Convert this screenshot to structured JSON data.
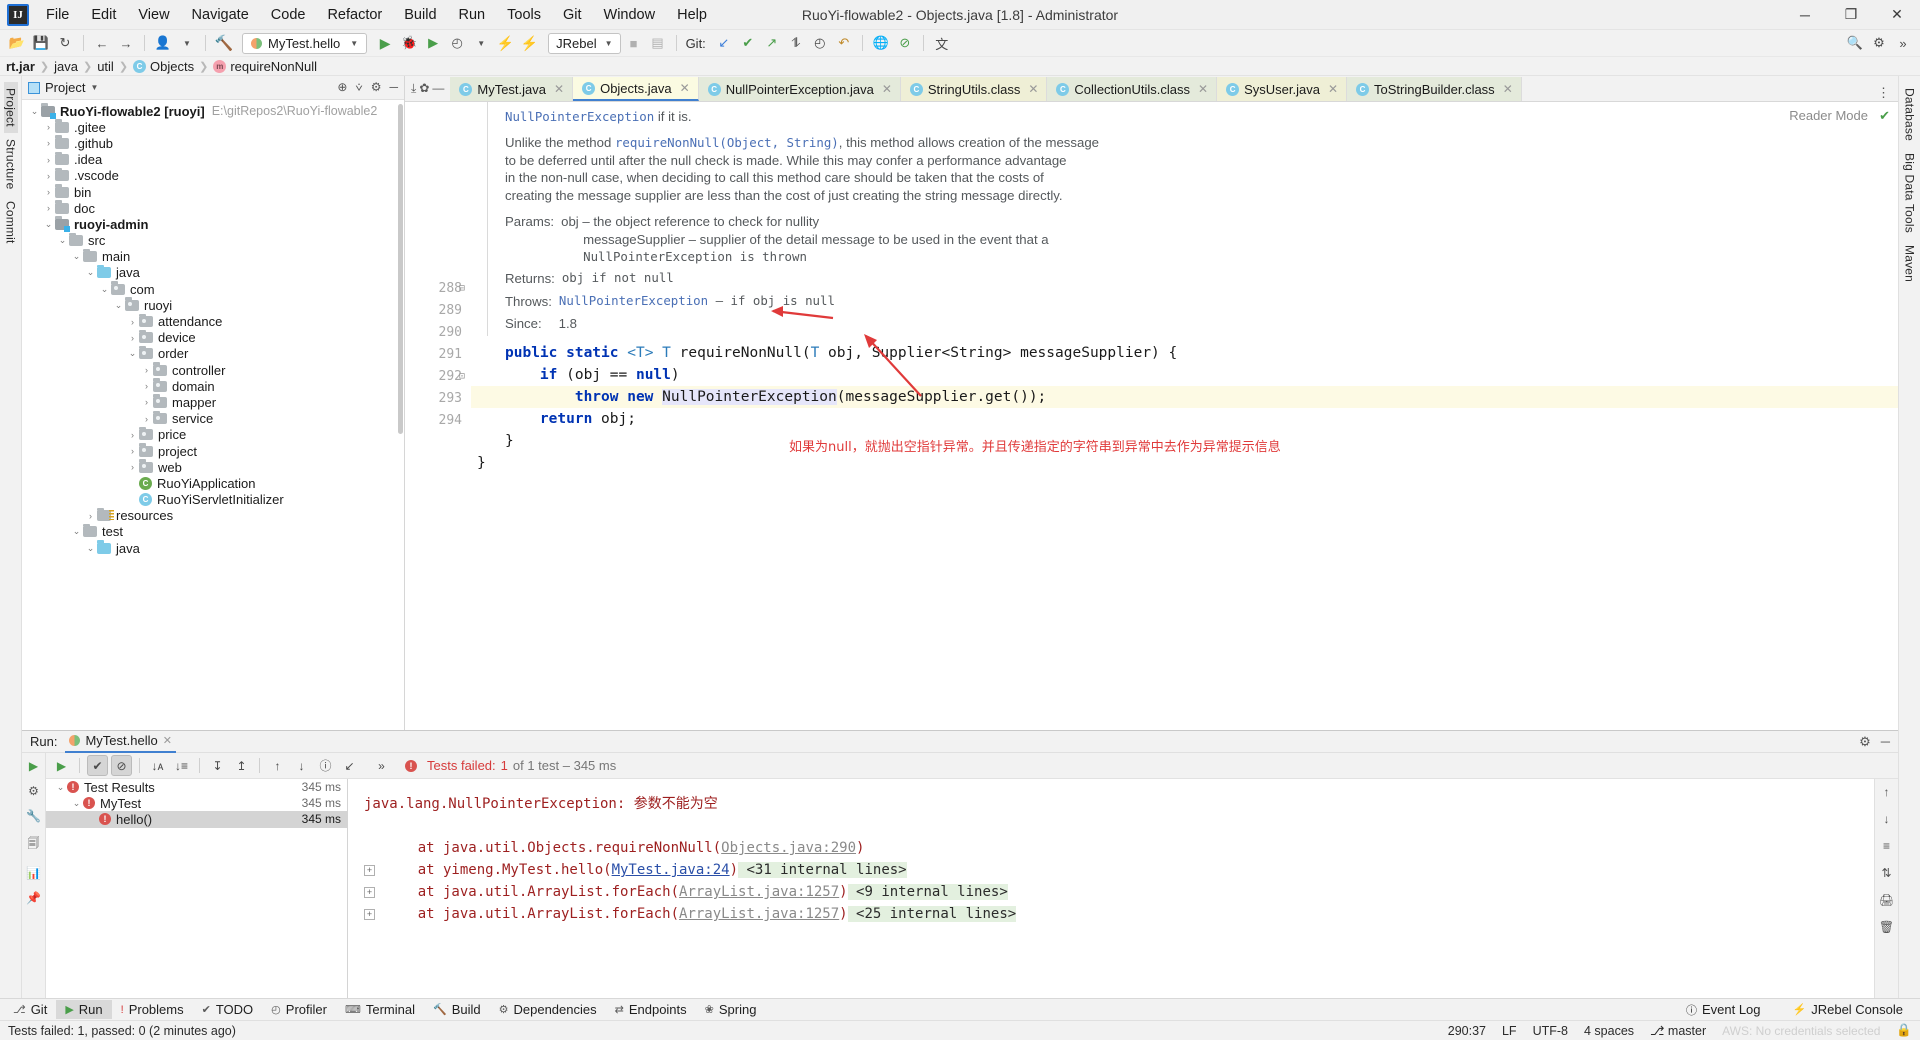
{
  "window": {
    "title": "RuoYi-flowable2 - Objects.java [1.8] - Administrator",
    "logo": "IJ",
    "minimize": "─",
    "maximize": "❐",
    "close": "✕"
  },
  "menubar": [
    {
      "label": "File"
    },
    {
      "label": "Edit"
    },
    {
      "label": "View"
    },
    {
      "label": "Navigate"
    },
    {
      "label": "Code"
    },
    {
      "label": "Refactor"
    },
    {
      "label": "Build"
    },
    {
      "label": "Run"
    },
    {
      "label": "Tools"
    },
    {
      "label": "Git"
    },
    {
      "label": "Window"
    },
    {
      "label": "Help"
    }
  ],
  "toolbar": {
    "open_icon": "📂",
    "save_icon": "💾",
    "sync_icon": "↻",
    "back_icon": "←",
    "forward_icon": "→",
    "profile_icon": "👤",
    "build_icon": "🔨",
    "run_config": "MyTest.hello",
    "run_icon": "▶",
    "debug_icon": "🐞",
    "run_coverage_icon": "▶",
    "profiler_icon": "◴",
    "jrebel_run_icon": "⚡",
    "jrebel_label": "JRebel",
    "stop_icon": "■",
    "layout_icon": "▤",
    "git_label": "Git:",
    "git_update_icon": "↙",
    "git_commit_icon": "✔",
    "git_push_icon": "↗",
    "git_branch_icon": "⥮",
    "git_history_icon": "◴",
    "undo_icon": "↶",
    "browser_icon": "🌐",
    "inspect_icon": "⊘",
    "translate_icon": "文",
    "search_icon": "🔍",
    "settings_icon": "⚙",
    "expand_icon": "»"
  },
  "breadcrumb": [
    {
      "label": "rt.jar",
      "bold": true,
      "icon": null
    },
    {
      "label": "java",
      "bold": false,
      "icon": null
    },
    {
      "label": "util",
      "bold": false,
      "icon": null
    },
    {
      "label": "Objects",
      "bold": false,
      "icon": "C"
    },
    {
      "label": "requireNonNull",
      "bold": false,
      "icon": "m"
    }
  ],
  "left_rail": [
    "Project",
    "Structure",
    "Commit"
  ],
  "right_rail": [
    "Database",
    "Big Data Tools",
    "Maven"
  ],
  "project_panel": {
    "title": "Project",
    "chevron": "▾",
    "locate_icon": "⊕",
    "collapse_icon": "⩒",
    "settings_icon": "⚙",
    "hide_icon": "─",
    "tree": [
      {
        "indent": 0,
        "arrow": "⌄",
        "type": "module",
        "label": "RuoYi-flowable2 [ruoyi]",
        "bold": true,
        "path": "E:\\gitRepos2\\RuoYi-flowable2"
      },
      {
        "indent": 1,
        "arrow": "›",
        "type": "folder",
        "label": ".gitee"
      },
      {
        "indent": 1,
        "arrow": "›",
        "type": "folder",
        "label": ".github"
      },
      {
        "indent": 1,
        "arrow": "›",
        "type": "folder",
        "label": ".idea"
      },
      {
        "indent": 1,
        "arrow": "›",
        "type": "folder",
        "label": ".vscode"
      },
      {
        "indent": 1,
        "arrow": "›",
        "type": "folder",
        "label": "bin"
      },
      {
        "indent": 1,
        "arrow": "›",
        "type": "folder",
        "label": "doc"
      },
      {
        "indent": 1,
        "arrow": "⌄",
        "type": "module",
        "label": "ruoyi-admin",
        "bold": true
      },
      {
        "indent": 2,
        "arrow": "⌄",
        "type": "folder",
        "label": "src"
      },
      {
        "indent": 3,
        "arrow": "⌄",
        "type": "folder",
        "label": "main"
      },
      {
        "indent": 4,
        "arrow": "⌄",
        "type": "source",
        "label": "java"
      },
      {
        "indent": 5,
        "arrow": "⌄",
        "type": "package",
        "label": "com"
      },
      {
        "indent": 6,
        "arrow": "⌄",
        "type": "package",
        "label": "ruoyi"
      },
      {
        "indent": 7,
        "arrow": "›",
        "type": "package",
        "label": "attendance"
      },
      {
        "indent": 7,
        "arrow": "›",
        "type": "package",
        "label": "device"
      },
      {
        "indent": 7,
        "arrow": "⌄",
        "type": "package",
        "label": "order"
      },
      {
        "indent": 8,
        "arrow": "›",
        "type": "package",
        "label": "controller"
      },
      {
        "indent": 8,
        "arrow": "›",
        "type": "package",
        "label": "domain"
      },
      {
        "indent": 8,
        "arrow": "›",
        "type": "package",
        "label": "mapper"
      },
      {
        "indent": 8,
        "arrow": "›",
        "type": "package",
        "label": "service"
      },
      {
        "indent": 7,
        "arrow": "›",
        "type": "package",
        "label": "price"
      },
      {
        "indent": 7,
        "arrow": "›",
        "type": "package",
        "label": "project"
      },
      {
        "indent": 7,
        "arrow": "›",
        "type": "package",
        "label": "web"
      },
      {
        "indent": 7,
        "arrow": "",
        "type": "spring-class",
        "label": "RuoYiApplication"
      },
      {
        "indent": 7,
        "arrow": "",
        "type": "class",
        "label": "RuoYiServletInitializer"
      },
      {
        "indent": 4,
        "arrow": "›",
        "type": "resources",
        "label": "resources"
      },
      {
        "indent": 3,
        "arrow": "⌄",
        "type": "folder",
        "label": "test"
      },
      {
        "indent": 4,
        "arrow": "⌄",
        "type": "source",
        "label": "java"
      }
    ]
  },
  "editor": {
    "tabs": [
      {
        "label": "MyTest.java",
        "icon": "C",
        "active": false,
        "modified": true
      },
      {
        "label": "Objects.java",
        "icon": "C",
        "active": true
      },
      {
        "label": "NullPointerException.java",
        "icon": "C",
        "active": false
      },
      {
        "label": "StringUtils.class",
        "icon": "C",
        "active": false
      },
      {
        "label": "CollectionUtils.class",
        "icon": "C",
        "active": false
      },
      {
        "label": "SysUser.java",
        "icon": "C",
        "active": false
      },
      {
        "label": "ToStringBuilder.class",
        "icon": "C",
        "active": false
      }
    ],
    "tab_close": "✕",
    "tab_overflow": "⋮",
    "reader_mode": "Reader Mode",
    "inspection_ok": "✔",
    "javadoc": {
      "line1_pre": "",
      "line1_link": "NullPointerException",
      "line1_post": " if it is.",
      "para2_a": "Unlike the method ",
      "para2_code": "requireNonNull(Object, String)",
      "para2_b": ", this method allows creation of the message",
      "para2_lines": [
        "to be deferred until after the null check is made. While this may confer a performance advantage",
        "in the non-null case, when deciding to call this method care should be taken that the costs of",
        "creating the message supplier are less than the cost of just creating the string message directly."
      ],
      "params_key": "Params:",
      "params": [
        "obj – the object reference to check for nullity",
        "messageSupplier – supplier of the detail message to be used in the event that a",
        "NullPointerException is thrown"
      ],
      "returns_key": "Returns:",
      "returns_val": "obj if not null",
      "throws_key": "Throws:",
      "throws_link": "NullPointerException",
      "throws_val": " – if obj is null",
      "since_key": "Since:",
      "since_val": "1.8"
    },
    "line_numbers": [
      "288",
      "289",
      "290",
      "291",
      "292",
      "293",
      "294"
    ],
    "code": [
      "public static <T> T requireNonNull(T obj, Supplier<String> messageSupplier) {",
      "    if (obj == null)",
      "        throw new NullPointerException(messageSupplier.get());",
      "    return obj;",
      "}",
      "}",
      ""
    ],
    "highlight_line": "290",
    "annotation_cn": "如果为null，就抛出空指针异常。并且传递指定的字符串到异常中去作为异常提示信息",
    "annotation_color": "#e03a3a"
  },
  "run_panel": {
    "label": "Run:",
    "tab_name": "MyTest.hello",
    "tab_close": "✕",
    "settings_icon": "⚙",
    "hide_icon": "─",
    "toolbar": {
      "rerun_icon": "▶",
      "show_passed_icon": "✔",
      "show_ignored_icon": "⊘",
      "sort_alpha_icon": "↓ᴀ",
      "sort_duration_icon": "↓≡",
      "expand_all_icon": "↧",
      "collapse_all_icon": "↥",
      "prev_fail_icon": "↑",
      "next_fail_icon": "↓",
      "history_icon": "ⓘ",
      "export_icon": "↙",
      "more_icon": "»"
    },
    "status_icon": "!",
    "status_prefix": "Tests failed:",
    "status_count": "1",
    "status_suffix": "of 1 test – 345 ms",
    "status_color": "#d63b3b",
    "tree": [
      {
        "indent": 0,
        "arrow": "⌄",
        "label": "Test Results",
        "time": "345 ms",
        "selected": false
      },
      {
        "indent": 1,
        "arrow": "⌄",
        "label": "MyTest",
        "time": "345 ms",
        "selected": false
      },
      {
        "indent": 2,
        "arrow": "",
        "label": "hello()",
        "time": "345 ms",
        "selected": true
      }
    ],
    "console": {
      "exception_line": "java.lang.NullPointerException: 参数不能为空",
      "frames": [
        {
          "fold": false,
          "text_pre": "    at java.util.Objects.requireNonNull(",
          "link": "Objects.java:290",
          "link_style": "gray",
          "text_post": ")",
          "internal": ""
        },
        {
          "fold": true,
          "text_pre": "    at yimeng.MyTest.hello(",
          "link": "MyTest.java:24",
          "link_style": "blue",
          "text_post": ")",
          "internal": "<31 internal lines>"
        },
        {
          "fold": true,
          "text_pre": "    at java.util.ArrayList.forEach(",
          "link": "ArrayList.java:1257",
          "link_style": "gray",
          "text_post": ")",
          "internal": "<9 internal lines>"
        },
        {
          "fold": true,
          "text_pre": "    at java.util.ArrayList.forEach(",
          "link": "ArrayList.java:1257",
          "link_style": "gray",
          "text_post": ")",
          "internal": "<25 internal lines>"
        }
      ]
    },
    "console_rail_icons": [
      "↑",
      "↓",
      "≡",
      "⇅",
      "🖨",
      "🗑"
    ],
    "left_rail_icons": [
      "▶",
      "⚙",
      "🔧",
      "📋",
      "📊",
      "📌"
    ]
  },
  "tool_window_bar": [
    {
      "label": "Git",
      "icon": "⎇",
      "selected": false
    },
    {
      "label": "Run",
      "icon": "▶",
      "selected": true
    },
    {
      "label": "Problems",
      "icon": "!",
      "selected": false
    },
    {
      "label": "TODO",
      "icon": "✔",
      "selected": false
    },
    {
      "label": "Profiler",
      "icon": "◴",
      "selected": false
    },
    {
      "label": "Terminal",
      "icon": "⌨",
      "selected": false
    },
    {
      "label": "Build",
      "icon": "🔨",
      "selected": false
    },
    {
      "label": "Dependencies",
      "icon": "⚙",
      "selected": false
    },
    {
      "label": "Endpoints",
      "icon": "⇄",
      "selected": false
    },
    {
      "label": "Spring",
      "icon": "❀",
      "selected": false
    }
  ],
  "tool_window_bar_right": [
    {
      "label": "Event Log",
      "icon": "ⓘ"
    },
    {
      "label": "JRebel Console",
      "icon": "⚡"
    }
  ],
  "status_bar": {
    "message": "Tests failed: 1, passed: 0 (2 minutes ago)",
    "caret": "290:37",
    "line_sep": "LF",
    "encoding": "UTF-8",
    "indent": "4 spaces",
    "branch": "master",
    "branch_icon": "⎇",
    "watermark": "AWS: No credentials selected",
    "lock_icon": "🔒"
  }
}
